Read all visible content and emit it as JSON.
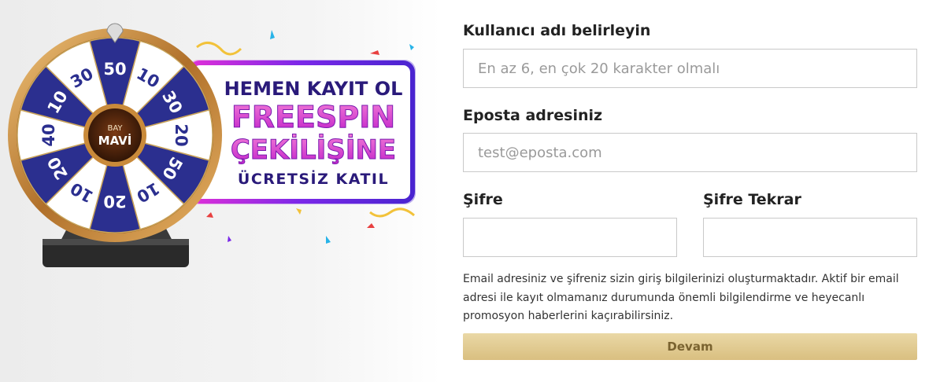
{
  "promo": {
    "brand_small": "BAY",
    "brand_large": "MAVİ",
    "headline": "HEMEN KAYIT OL",
    "line2": "FREESPIN",
    "line3": "ÇEKİLİŞİNE",
    "line4": "ÜCRETSİZ KATIL",
    "wheel_values": [
      "50",
      "10",
      "30",
      "20",
      "50",
      "10",
      "20",
      "10",
      "20",
      "40",
      "10",
      "30"
    ]
  },
  "form": {
    "username_label": "Kullanıcı adı belirleyin",
    "username_placeholder": "En az 6, en çok 20 karakter olmalı",
    "email_label": "Eposta adresiniz",
    "email_placeholder": "test@eposta.com",
    "password_label": "Şifre",
    "password_confirm_label": "Şifre Tekrar",
    "notice": "Email adresiniz ve şifreniz sizin giriş bilgilerinizi oluşturmaktadır. Aktif bir email adresi ile kayıt olmamanız durumunda önemli bilgilendirme ve heyecanlı promosyon haberlerini kaçırabilirsiniz.",
    "submit_label": "Devam"
  },
  "colors": {
    "wheel_blue": "#2b2f8f",
    "rim_gold": "#c98a3a",
    "banner_purple": "#5b1cc7",
    "banner_pink": "#d63ad8",
    "button_gold": "#e0c98f"
  }
}
